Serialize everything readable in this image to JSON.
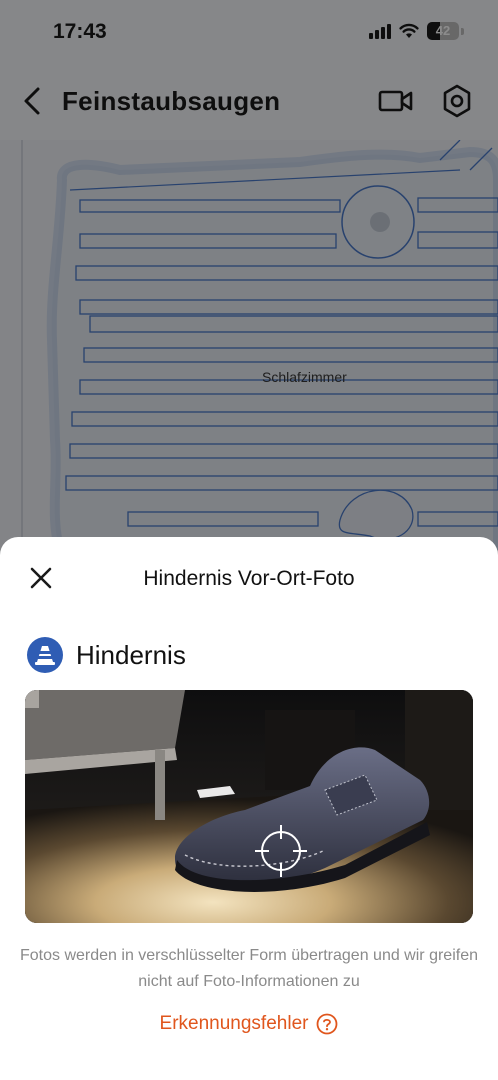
{
  "status_bar": {
    "time": "17:43",
    "battery_percent": "42"
  },
  "nav": {
    "title": "Feinstaubsaugen"
  },
  "map": {
    "room_label": "Schlafzimmer"
  },
  "sheet": {
    "title": "Hindernis Vor-Ort-Foto",
    "obstacle_type": "Hindernis",
    "privacy_note": "Fotos werden in verschlüsselter Form übertragen und wir greifen nicht auf Foto-Informationen zu",
    "error_link": "Erkennungsfehler"
  },
  "colors": {
    "accent_orange": "#e0561d",
    "badge_blue": "#2f5db4",
    "map_path_blue": "#4a78c8"
  },
  "icons": [
    "back-icon",
    "video-camera-icon",
    "settings-icon",
    "close-icon",
    "traffic-cone-icon",
    "crosshair-icon",
    "help-icon"
  ]
}
